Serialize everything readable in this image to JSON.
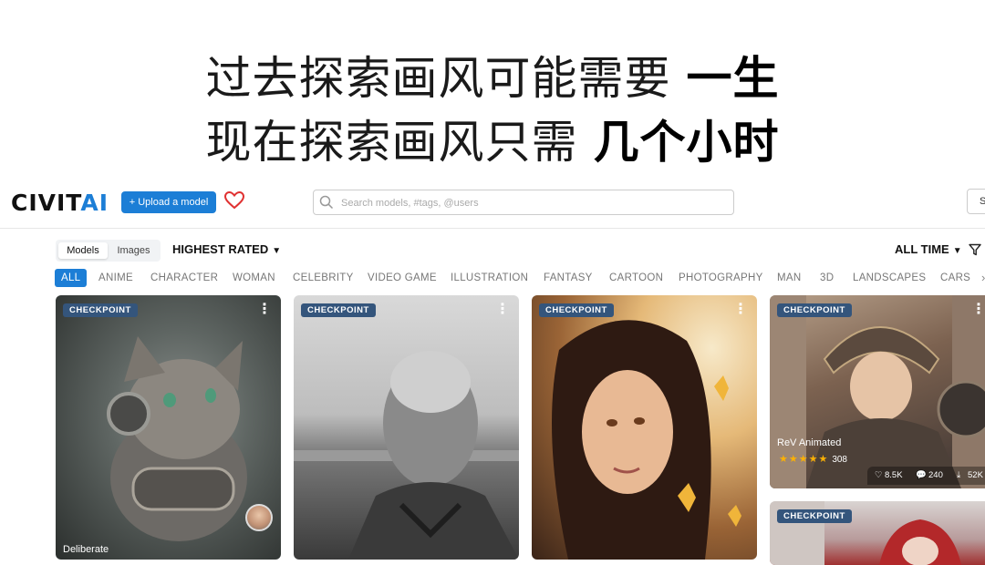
{
  "headline": {
    "line1_light": "过去探索画风可能需要",
    "line1_bold": "一生",
    "line2_light": "现在探索画风只需",
    "line2_bold": "几个小时"
  },
  "header": {
    "logo_main": "CIVIT",
    "logo_accent": "AI",
    "upload_label": "+ Upload a model",
    "search_placeholder": "Search models, #tags, @users",
    "right_button_partial": "S",
    "icons": [
      "heart-icon",
      "search-icon"
    ]
  },
  "toolbar": {
    "segments": [
      "Models",
      "Images"
    ],
    "active_segment": "Models",
    "sort_label": "HIGHEST RATED",
    "time_label": "ALL TIME",
    "icons": [
      "chevron-down-icon",
      "filter-icon"
    ]
  },
  "tags": [
    "ALL",
    "ANIME",
    "CHARACTER",
    "WOMAN",
    "CELEBRITY",
    "VIDEO GAME",
    "ILLUSTRATION",
    "FANTASY",
    "CARTOON",
    "PHOTOGRAPHY",
    "MAN",
    "3D",
    "LANDSCAPES",
    "CARS"
  ],
  "active_tag": "ALL",
  "cards": [
    {
      "badge": "CHECKPOINT",
      "name": "Deliberate"
    },
    {
      "badge": "CHECKPOINT"
    },
    {
      "badge": "CHECKPOINT"
    },
    {
      "badge": "CHECKPOINT",
      "name": "ReV Animated",
      "rating_stars": 5,
      "rating_count": "308",
      "likes": "8.5K",
      "comments": "240",
      "downloads": "52K"
    },
    {
      "badge": "CHECKPOINT"
    }
  ],
  "colors": {
    "accent": "#1c7ed6",
    "badge": "#34557c",
    "star": "#fab005",
    "heart": "#e03131"
  }
}
